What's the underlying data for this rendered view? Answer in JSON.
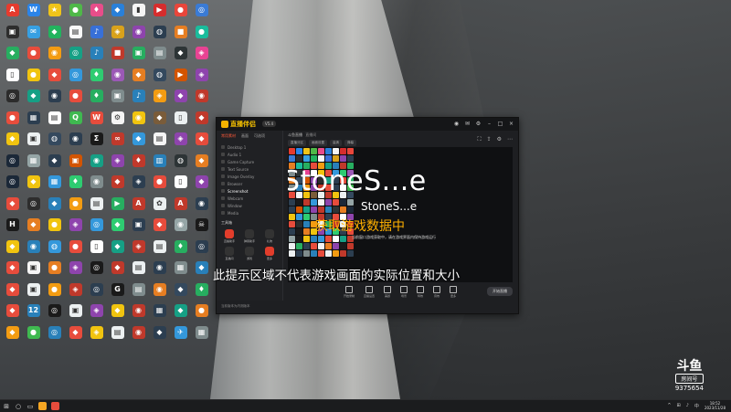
{
  "desktop": {
    "icons": [
      {
        "label": "",
        "color": "#e63b2e",
        "glyph": "A"
      },
      {
        "label": "",
        "color": "#2b84e8",
        "glyph": "W"
      },
      {
        "label": "",
        "color": "#f0c419",
        "glyph": "★"
      },
      {
        "label": "",
        "color": "#4fb848",
        "glyph": "●"
      },
      {
        "label": "",
        "color": "#e84d8a",
        "glyph": "♦"
      },
      {
        "label": "",
        "color": "#2980d9",
        "glyph": "◆"
      },
      {
        "label": "",
        "color": "#f5f5f5",
        "glyph": "▮"
      },
      {
        "label": "",
        "color": "#d62d2d",
        "glyph": "▶"
      },
      {
        "label": "",
        "color": "#e8463b",
        "glyph": "●"
      },
      {
        "label": "",
        "color": "#3a7bd5",
        "glyph": "◎"
      },
      {
        "label": "",
        "color": "#2d2d2d",
        "glyph": "▣"
      },
      {
        "label": "",
        "color": "#37a0e3",
        "glyph": "✉"
      },
      {
        "label": "",
        "color": "#22b35e",
        "glyph": "◆"
      },
      {
        "label": "",
        "color": "#f8f8f8",
        "glyph": "▤"
      },
      {
        "label": "",
        "color": "#3870d8",
        "glyph": "♪"
      },
      {
        "label": "",
        "color": "#d9a21b",
        "glyph": "◈"
      },
      {
        "label": "",
        "color": "#8e44ad",
        "glyph": "◉"
      },
      {
        "label": "",
        "color": "#2c3e50",
        "glyph": "◍"
      },
      {
        "label": "",
        "color": "#e67e22",
        "glyph": "■"
      },
      {
        "label": "",
        "color": "#1abc9c",
        "glyph": "●"
      },
      {
        "label": "",
        "color": "#27ae60",
        "glyph": "◆"
      },
      {
        "label": "",
        "color": "#e74c3c",
        "glyph": "●"
      },
      {
        "label": "",
        "color": "#f39c12",
        "glyph": "◉"
      },
      {
        "label": "",
        "color": "#16a085",
        "glyph": "◎"
      },
      {
        "label": "",
        "color": "#2980b9",
        "glyph": "♪"
      },
      {
        "label": "",
        "color": "#c0392b",
        "glyph": "■"
      },
      {
        "label": "",
        "color": "#27ae60",
        "glyph": "▣"
      },
      {
        "label": "",
        "color": "#7f8c8d",
        "glyph": "▤"
      },
      {
        "label": "",
        "color": "#2d3436",
        "glyph": "◆"
      },
      {
        "label": "",
        "color": "#e84393",
        "glyph": "◈"
      },
      {
        "label": "",
        "color": "#ffffff",
        "glyph": "▯"
      },
      {
        "label": "",
        "color": "#f1c40f",
        "glyph": "●"
      },
      {
        "label": "",
        "color": "#e74c3c",
        "glyph": "◆"
      },
      {
        "label": "",
        "color": "#3498db",
        "glyph": "◎"
      },
      {
        "label": "",
        "color": "#2ecc71",
        "glyph": "♦"
      },
      {
        "label": "",
        "color": "#9b59b6",
        "glyph": "◉"
      },
      {
        "label": "",
        "color": "#e67e22",
        "glyph": "◆"
      },
      {
        "label": "",
        "color": "#34495e",
        "glyph": "◍"
      },
      {
        "label": "",
        "color": "#d35400",
        "glyph": "▶"
      },
      {
        "label": "",
        "color": "#8e44ad",
        "glyph": "◈"
      },
      {
        "label": "",
        "color": "#2c2c2c",
        "glyph": "◎"
      },
      {
        "label": "",
        "color": "#16a085",
        "glyph": "◆"
      },
      {
        "label": "",
        "color": "#2c3e50",
        "glyph": "◉"
      },
      {
        "label": "",
        "color": "#e74c3c",
        "glyph": "●"
      },
      {
        "label": "",
        "color": "#27ae60",
        "glyph": "♦"
      },
      {
        "label": "",
        "color": "#7f8c8d",
        "glyph": "▣"
      },
      {
        "label": "",
        "color": "#2980b9",
        "glyph": "♪"
      },
      {
        "label": "",
        "color": "#f39c12",
        "glyph": "◈"
      },
      {
        "label": "",
        "color": "#8e44ad",
        "glyph": "◆"
      },
      {
        "label": "",
        "color": "#c0392b",
        "glyph": "◉"
      },
      {
        "label": "",
        "color": "#e84d3c",
        "glyph": "●"
      },
      {
        "label": "",
        "color": "#2c3e50",
        "glyph": "▦"
      },
      {
        "label": "",
        "color": "#ffffff",
        "glyph": "▤"
      },
      {
        "label": "",
        "color": "#3fb950",
        "glyph": "Q"
      },
      {
        "label": "",
        "color": "#e74c3c",
        "glyph": "W"
      },
      {
        "label": "",
        "color": "#f5f5f5",
        "glyph": "⚙"
      },
      {
        "label": "",
        "color": "#f1c40f",
        "glyph": "◉"
      },
      {
        "label": "",
        "color": "#7a5c3a",
        "glyph": "◆"
      },
      {
        "label": "",
        "color": "#ecf0f1",
        "glyph": "▯"
      },
      {
        "label": "",
        "color": "#c0392b",
        "glyph": "◆"
      },
      {
        "label": "",
        "color": "#f1c40f",
        "glyph": "◆"
      },
      {
        "label": "",
        "color": "#ecf0f1",
        "glyph": "▣"
      },
      {
        "label": "",
        "color": "#34495e",
        "glyph": "◍"
      },
      {
        "label": "",
        "color": "#2c3e50",
        "glyph": "◉"
      },
      {
        "label": "",
        "color": "#1a1a1a",
        "glyph": "Σ"
      },
      {
        "label": "",
        "color": "#c0392b",
        "glyph": "∞"
      },
      {
        "label": "",
        "color": "#3498db",
        "glyph": "◆"
      },
      {
        "label": "",
        "color": "#f5f5f5",
        "glyph": "▤"
      },
      {
        "label": "",
        "color": "#8e44ad",
        "glyph": "◈"
      },
      {
        "label": "",
        "color": "#e74c3c",
        "glyph": "◆"
      },
      {
        "label": "",
        "color": "#1b2838",
        "glyph": "◎"
      },
      {
        "label": "",
        "color": "#95a5a6",
        "glyph": "▦"
      },
      {
        "label": "",
        "color": "#2c3e50",
        "glyph": "◆"
      },
      {
        "label": "",
        "color": "#d35400",
        "glyph": "▣"
      },
      {
        "label": "",
        "color": "#16a085",
        "glyph": "◉"
      },
      {
        "label": "",
        "color": "#8e44ad",
        "glyph": "◈"
      },
      {
        "label": "",
        "color": "#c0392b",
        "glyph": "♦"
      },
      {
        "label": "",
        "color": "#2980b9",
        "glyph": "▥"
      },
      {
        "label": "",
        "color": "#2d3436",
        "glyph": "◍"
      },
      {
        "label": "",
        "color": "#e67e22",
        "glyph": "◆"
      },
      {
        "label": "",
        "color": "#1b2838",
        "glyph": "◎"
      },
      {
        "label": "",
        "color": "#f1c40f",
        "glyph": "◆"
      },
      {
        "label": "",
        "color": "#3498db",
        "glyph": "▦"
      },
      {
        "label": "",
        "color": "#2ecc71",
        "glyph": "♦"
      },
      {
        "label": "",
        "color": "#7f8c8d",
        "glyph": "◉"
      },
      {
        "label": "",
        "color": "#c0392b",
        "glyph": "◆"
      },
      {
        "label": "",
        "color": "#2c3e50",
        "glyph": "◈"
      },
      {
        "label": "",
        "color": "#e74c3c",
        "glyph": "●"
      },
      {
        "label": "",
        "color": "#ffffff",
        "glyph": "▯"
      },
      {
        "label": "",
        "color": "#8e44ad",
        "glyph": "◆"
      },
      {
        "label": "",
        "color": "#e74c3c",
        "glyph": "◆"
      },
      {
        "label": "",
        "color": "#2d2d2d",
        "glyph": "◎"
      },
      {
        "label": "",
        "color": "#2980b9",
        "glyph": "◆"
      },
      {
        "label": "",
        "color": "#f39c12",
        "glyph": "●"
      },
      {
        "label": "",
        "color": "#ecf0f1",
        "glyph": "▤"
      },
      {
        "label": "",
        "color": "#27ae60",
        "glyph": "▶"
      },
      {
        "label": "",
        "color": "#c0392b",
        "glyph": "A"
      },
      {
        "label": "",
        "color": "#ecf0f1",
        "glyph": "✿"
      },
      {
        "label": "",
        "color": "#c0392b",
        "glyph": "A"
      },
      {
        "label": "",
        "color": "#2c3e50",
        "glyph": "◉"
      },
      {
        "label": "",
        "color": "#1a1a1a",
        "glyph": "H"
      },
      {
        "label": "",
        "color": "#e67e22",
        "glyph": "◆"
      },
      {
        "label": "",
        "color": "#f1c40f",
        "glyph": "●"
      },
      {
        "label": "",
        "color": "#8e44ad",
        "glyph": "◈"
      },
      {
        "label": "",
        "color": "#3498db",
        "glyph": "◎"
      },
      {
        "label": "",
        "color": "#2ecc71",
        "glyph": "◆"
      },
      {
        "label": "",
        "color": "#2c3e50",
        "glyph": "▣"
      },
      {
        "label": "",
        "color": "#e74c3c",
        "glyph": "◆"
      },
      {
        "label": "",
        "color": "#95a5a6",
        "glyph": "◉"
      },
      {
        "label": "",
        "color": "#1a1a1a",
        "glyph": "☠"
      },
      {
        "label": "",
        "color": "#f1c40f",
        "glyph": "◆"
      },
      {
        "label": "",
        "color": "#2980b9",
        "glyph": "◉"
      },
      {
        "label": "",
        "color": "#3498db",
        "glyph": "◍"
      },
      {
        "label": "",
        "color": "#e74c3c",
        "glyph": "●"
      },
      {
        "label": "",
        "color": "#ffffff",
        "glyph": "▯"
      },
      {
        "label": "",
        "color": "#16a085",
        "glyph": "◆"
      },
      {
        "label": "",
        "color": "#c0392b",
        "glyph": "◈"
      },
      {
        "label": "",
        "color": "#ecf0f1",
        "glyph": "▤"
      },
      {
        "label": "",
        "color": "#27ae60",
        "glyph": "♦"
      },
      {
        "label": "",
        "color": "#2c3e50",
        "glyph": "◎"
      },
      {
        "label": "",
        "color": "#e74c3c",
        "glyph": "◆"
      },
      {
        "label": "",
        "color": "#f5f5f5",
        "glyph": "▣"
      },
      {
        "label": "",
        "color": "#e67e22",
        "glyph": "●"
      },
      {
        "label": "",
        "color": "#8e44ad",
        "glyph": "◈"
      },
      {
        "label": "",
        "color": "#1a1a1a",
        "glyph": "◎"
      },
      {
        "label": "",
        "color": "#c0392b",
        "glyph": "◆"
      },
      {
        "label": "",
        "color": "#ecf0f1",
        "glyph": "▤"
      },
      {
        "label": "",
        "color": "#2c3e50",
        "glyph": "◉"
      },
      {
        "label": "",
        "color": "#7f8c8d",
        "glyph": "▦"
      },
      {
        "label": "",
        "color": "#2980b9",
        "glyph": "◆"
      },
      {
        "label": "",
        "color": "#e74c3c",
        "glyph": "◆"
      },
      {
        "label": "",
        "color": "#ecf0f1",
        "glyph": "▣"
      },
      {
        "label": "",
        "color": "#f39c12",
        "glyph": "●"
      },
      {
        "label": "",
        "color": "#c0392b",
        "glyph": "◈"
      },
      {
        "label": "",
        "color": "#2c3e50",
        "glyph": "◎"
      },
      {
        "label": "",
        "color": "#1a1a1a",
        "glyph": "G"
      },
      {
        "label": "",
        "color": "#7f8c8d",
        "glyph": "▤"
      },
      {
        "label": "",
        "color": "#e67e22",
        "glyph": "◉"
      },
      {
        "label": "",
        "color": "#34495e",
        "glyph": "◆"
      },
      {
        "label": "",
        "color": "#27ae60",
        "glyph": "♦"
      },
      {
        "label": "",
        "color": "#e74c3c",
        "glyph": "◆"
      },
      {
        "label": "",
        "color": "#2980b9",
        "glyph": "12"
      },
      {
        "label": "",
        "color": "#1a1a1a",
        "glyph": "◎"
      },
      {
        "label": "",
        "color": "#ecf0f1",
        "glyph": "▣"
      },
      {
        "label": "",
        "color": "#8e44ad",
        "glyph": "◈"
      },
      {
        "label": "",
        "color": "#f1c40f",
        "glyph": "◆"
      },
      {
        "label": "",
        "color": "#c0392b",
        "glyph": "◉"
      },
      {
        "label": "",
        "color": "#2c3e50",
        "glyph": "▦"
      },
      {
        "label": "",
        "color": "#16a085",
        "glyph": "◆"
      },
      {
        "label": "",
        "color": "#e67e22",
        "glyph": "●"
      },
      {
        "label": "",
        "color": "#f39c12",
        "glyph": "◆"
      },
      {
        "label": "",
        "color": "#3fb950",
        "glyph": "●"
      },
      {
        "label": "",
        "color": "#2980b9",
        "glyph": "◎"
      },
      {
        "label": "",
        "color": "#e74c3c",
        "glyph": "◆"
      },
      {
        "label": "",
        "color": "#f1c40f",
        "glyph": "◈"
      },
      {
        "label": "",
        "color": "#ecf0f1",
        "glyph": "▤"
      },
      {
        "label": "",
        "color": "#c0392b",
        "glyph": "◉"
      },
      {
        "label": "",
        "color": "#2c3e50",
        "glyph": "◆"
      },
      {
        "label": "",
        "color": "#3498db",
        "glyph": "✈"
      },
      {
        "label": "",
        "color": "#7f8c8d",
        "glyph": "▦"
      }
    ]
  },
  "app": {
    "name": "直播伴侣",
    "version": "V5.4",
    "title_icons": [
      "avatar",
      "mail",
      "settings",
      "minimize",
      "maximize",
      "close"
    ],
    "left_tabs": [
      {
        "label": "常用素材",
        "active": true
      },
      {
        "label": "画面",
        "active": false
      },
      {
        "label": "可选项",
        "active": false
      }
    ],
    "sources": [
      {
        "label": "Desktop 1",
        "active": false
      },
      {
        "label": "Audio 1",
        "active": false
      },
      {
        "label": "Game Capture",
        "active": false
      },
      {
        "label": "Text Source",
        "active": false
      },
      {
        "label": "Image Overlay",
        "active": false
      },
      {
        "label": "Browser",
        "active": false
      },
      {
        "label": "Screenshot",
        "active": true
      },
      {
        "label": "Webcam",
        "active": false
      },
      {
        "label": "Window",
        "active": false
      },
      {
        "label": "Media",
        "active": false
      }
    ],
    "tools_heading": "工具箱",
    "tools": [
      {
        "label": "直播助手",
        "red": true
      },
      {
        "label": "弹幕助手",
        "red": false
      },
      {
        "label": "礼物",
        "red": false
      },
      {
        "label": "直播间",
        "red": false
      },
      {
        "label": "游戏",
        "red": false
      },
      {
        "label": "更多",
        "red": true
      }
    ],
    "footer_note": "当前版本为内测版本",
    "header_title": "斗鱼直播",
    "header_subtitle": "直播间",
    "chips": [
      "直播分区",
      "画面设置",
      "高清",
      "弹幕"
    ],
    "header_icons": [
      "fullscreen",
      "share",
      "settings",
      "more"
    ],
    "preview": {
      "big_title": "StoneS...e",
      "small_title": "StoneS...e",
      "status": "获取游戏数据中",
      "caption": "当前窗口游戏获取中，请在游戏界面内保持游戏运行"
    },
    "bottom_buttons": [
      "开始录制",
      "直播设置",
      "美颜",
      "场景",
      "特效",
      "音效",
      "更多"
    ],
    "start_button": "开始直播"
  },
  "overlay_hint": "此提示区域不代表游戏画面的实际位置和大小",
  "watermark": {
    "logo": "斗鱼",
    "badge": "房间号",
    "number": "9375654"
  },
  "taskbar": {
    "apps": [
      "#f5a623",
      "#e74c3c"
    ],
    "tray_icons": [
      "^",
      "⊞",
      "♪",
      "中"
    ],
    "time": "18:52",
    "date": "2023/11/28"
  }
}
